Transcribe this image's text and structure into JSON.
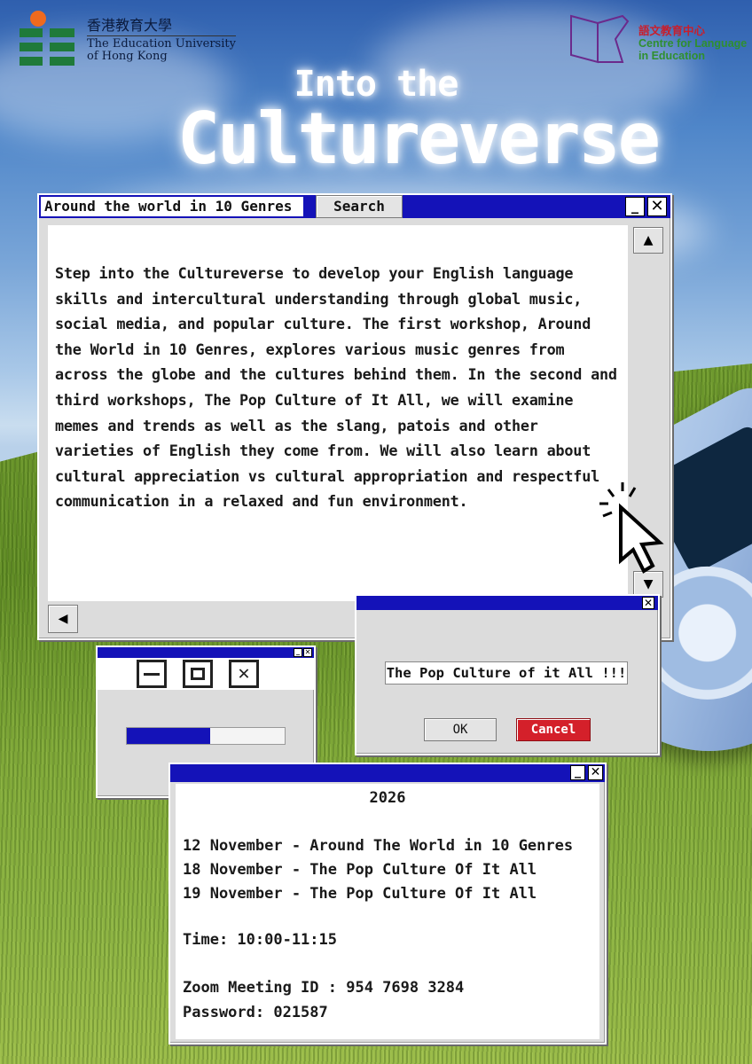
{
  "logos": {
    "eduhk": {
      "zh": "香港教育大學",
      "en_line1": "The Education University",
      "en_line2": "of Hong Kong"
    },
    "cle": {
      "zh": "語文教育中心",
      "en_line1": "Centre for Language",
      "en_line2": "in Education"
    }
  },
  "headline": {
    "line1": "Into the",
    "line2": "Cultureverse"
  },
  "main_window": {
    "search_value": "Around the world in 10 Genres",
    "search_button": "Search",
    "body": "Step into the Cultureverse to develop your English language skills and intercultural understanding through global music, social media, and popular culture. The first workshop, Around the World in 10 Genres, explores various music genres from across the globe and the cultures behind them. In the second and third workshops, The Pop Culture of It All, we will examine memes and trends as well as the slang, patois and other varieties of English they come from. We will also learn about cultural appreciation vs cultural appropriation and respectful communication in a relaxed and fun environment."
  },
  "progress_window": {
    "progress": 0.53
  },
  "dialog": {
    "field_value": "The Pop Culture of it All !!!",
    "ok_label": "OK",
    "cancel_label": "Cancel"
  },
  "schedule": {
    "year": "2026",
    "sessions": [
      "12 November - Around The World in 10 Genres",
      "18 November - The Pop Culture Of It All",
      "19 November - The Pop Culture Of It All"
    ],
    "time": "Time: 10:00-11:15",
    "zoom_id": "Zoom Meeting ID : 954 7698 3284",
    "password": "Password: 021587"
  },
  "colors": {
    "titlebar": "#1412b8",
    "cancel": "#d4202a",
    "progress": "#1412b8"
  }
}
